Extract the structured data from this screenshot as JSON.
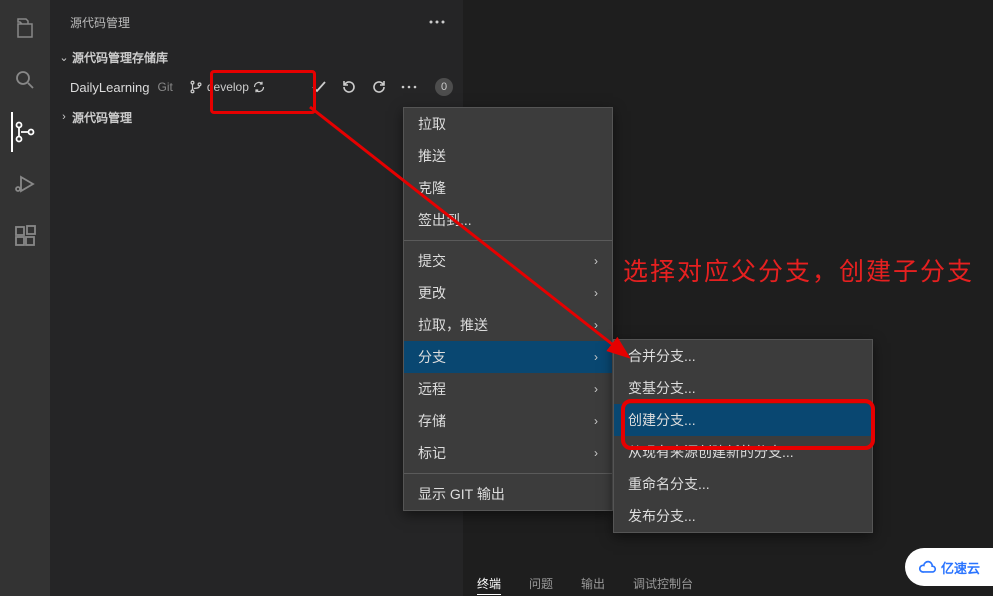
{
  "sidebar": {
    "title": "源代码管理",
    "section_repos": "源代码管理存储库",
    "section_scm": "源代码管理",
    "repo_name": "DailyLearning",
    "repo_type": "Git",
    "branch": "develop",
    "sync_count": "0"
  },
  "menu1": {
    "pull": "拉取",
    "push": "推送",
    "clone": "克隆",
    "checkout": "签出到...",
    "commit": "提交",
    "changes": "更改",
    "pullpush": "拉取，推送",
    "branch": "分支",
    "remote": "远程",
    "stash": "存储",
    "tag": "标记",
    "gitoutput": "显示 GIT 输出"
  },
  "menu2": {
    "merge": "合并分支...",
    "rebase": "变基分支...",
    "create": "创建分支...",
    "createfrom": "从现有来源创建新的分支...",
    "rename": "重命名分支...",
    "publish": "发布分支..."
  },
  "annotation": {
    "text": "选择对应父分支，创建子分支"
  },
  "bottom": {
    "terminal": "终端",
    "problems": "问题",
    "output": "输出",
    "debug": "调试控制台"
  },
  "watermark": "亿速云"
}
